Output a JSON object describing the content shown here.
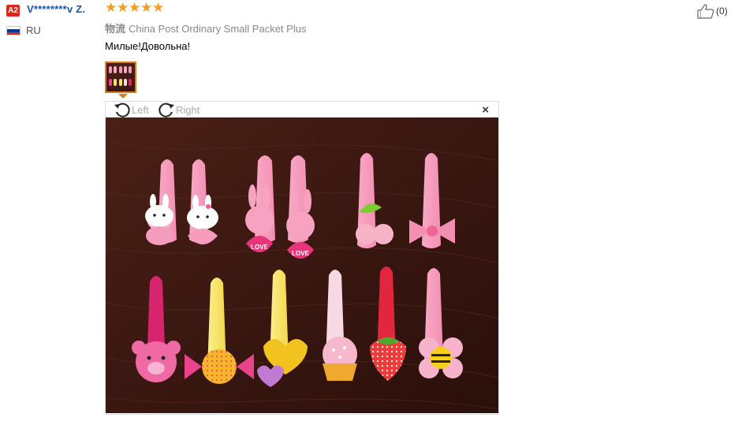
{
  "reviewer": {
    "badge": "A2",
    "badge_color": "#d9291c",
    "name": "V********v Z.",
    "country": "RU",
    "flag_colors": [
      "#ffffff",
      "#0039a6",
      "#d52b1e"
    ]
  },
  "rating": {
    "value": 5,
    "max": 5,
    "glyph": "★",
    "color": "#f59d1a"
  },
  "logistics": {
    "label": "物流",
    "value": "China Post Ordinary Small Packet Plus"
  },
  "comment": "Милые!Довольна!",
  "helpful": {
    "count": "(0)",
    "icon": "thumbs-up-icon"
  },
  "viewer": {
    "rotate_left_label": "Left",
    "rotate_right_label": "Right",
    "close_glyph": "×",
    "image_description": "twelve pink children's hair clips on a dark wooden table",
    "love_text": "LOVE"
  },
  "colors": {
    "accent": "#e07b1a",
    "link": "#1158a8",
    "wood": "#3b1a12"
  }
}
